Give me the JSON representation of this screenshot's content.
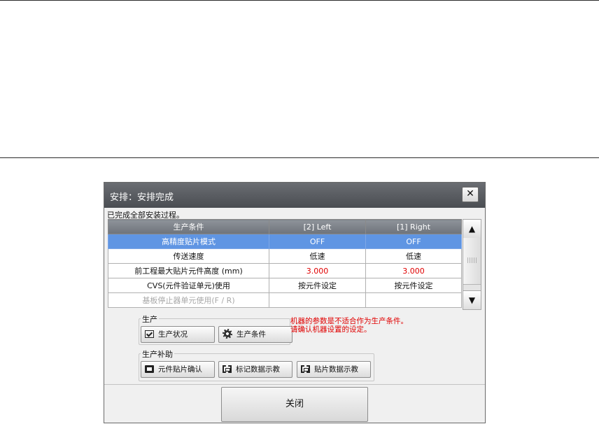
{
  "dialog": {
    "title": "安排：安排完成",
    "close_glyph": "✕",
    "status": "已完成全部安装过程。"
  },
  "table": {
    "headers": [
      "生产条件",
      "[2] Left",
      "[1] Right"
    ],
    "rows": [
      {
        "label": "高精度贴片模式",
        "left": "OFF",
        "right": "OFF",
        "state": "selected"
      },
      {
        "label": "传送速度",
        "left": "低速",
        "right": "低速",
        "state": "normal"
      },
      {
        "label": "前工程最大贴片元件高度 (mm)",
        "left": "3.000",
        "right": "3.000",
        "state": "warning",
        "value_color": "#e00000"
      },
      {
        "label": "CVS(元件验证单元)使用",
        "left": "按元件设定",
        "right": "按元件设定",
        "state": "normal"
      },
      {
        "label": "基板停止器单元使用(F / R)",
        "left": "",
        "right": "",
        "state": "disabled"
      }
    ],
    "scroll_up_icon": "▲",
    "scroll_down_icon": "▼"
  },
  "production": {
    "group_label": "生产",
    "status_button": {
      "label": "生产状况",
      "icon": "checkbox-icon"
    },
    "conditions_button": {
      "label": "生产条件",
      "icon": "gear-icon"
    },
    "warning": "机器的参数是不适合作为生产条件。\n请确认机器设置的设定。"
  },
  "assist": {
    "group_label": "生产补助",
    "buttons": [
      {
        "label": "元件贴片确认",
        "icon": "component-icon"
      },
      {
        "label": "标记数据示教",
        "icon": "mark-teach-icon"
      },
      {
        "label": "贴片数据示教",
        "icon": "placement-teach-icon"
      }
    ]
  },
  "footer": {
    "close_label": "关闭"
  },
  "colors": {
    "selected_row": "#5f95e3",
    "warning_text": "#e00000",
    "titlebar": "#55585d"
  }
}
